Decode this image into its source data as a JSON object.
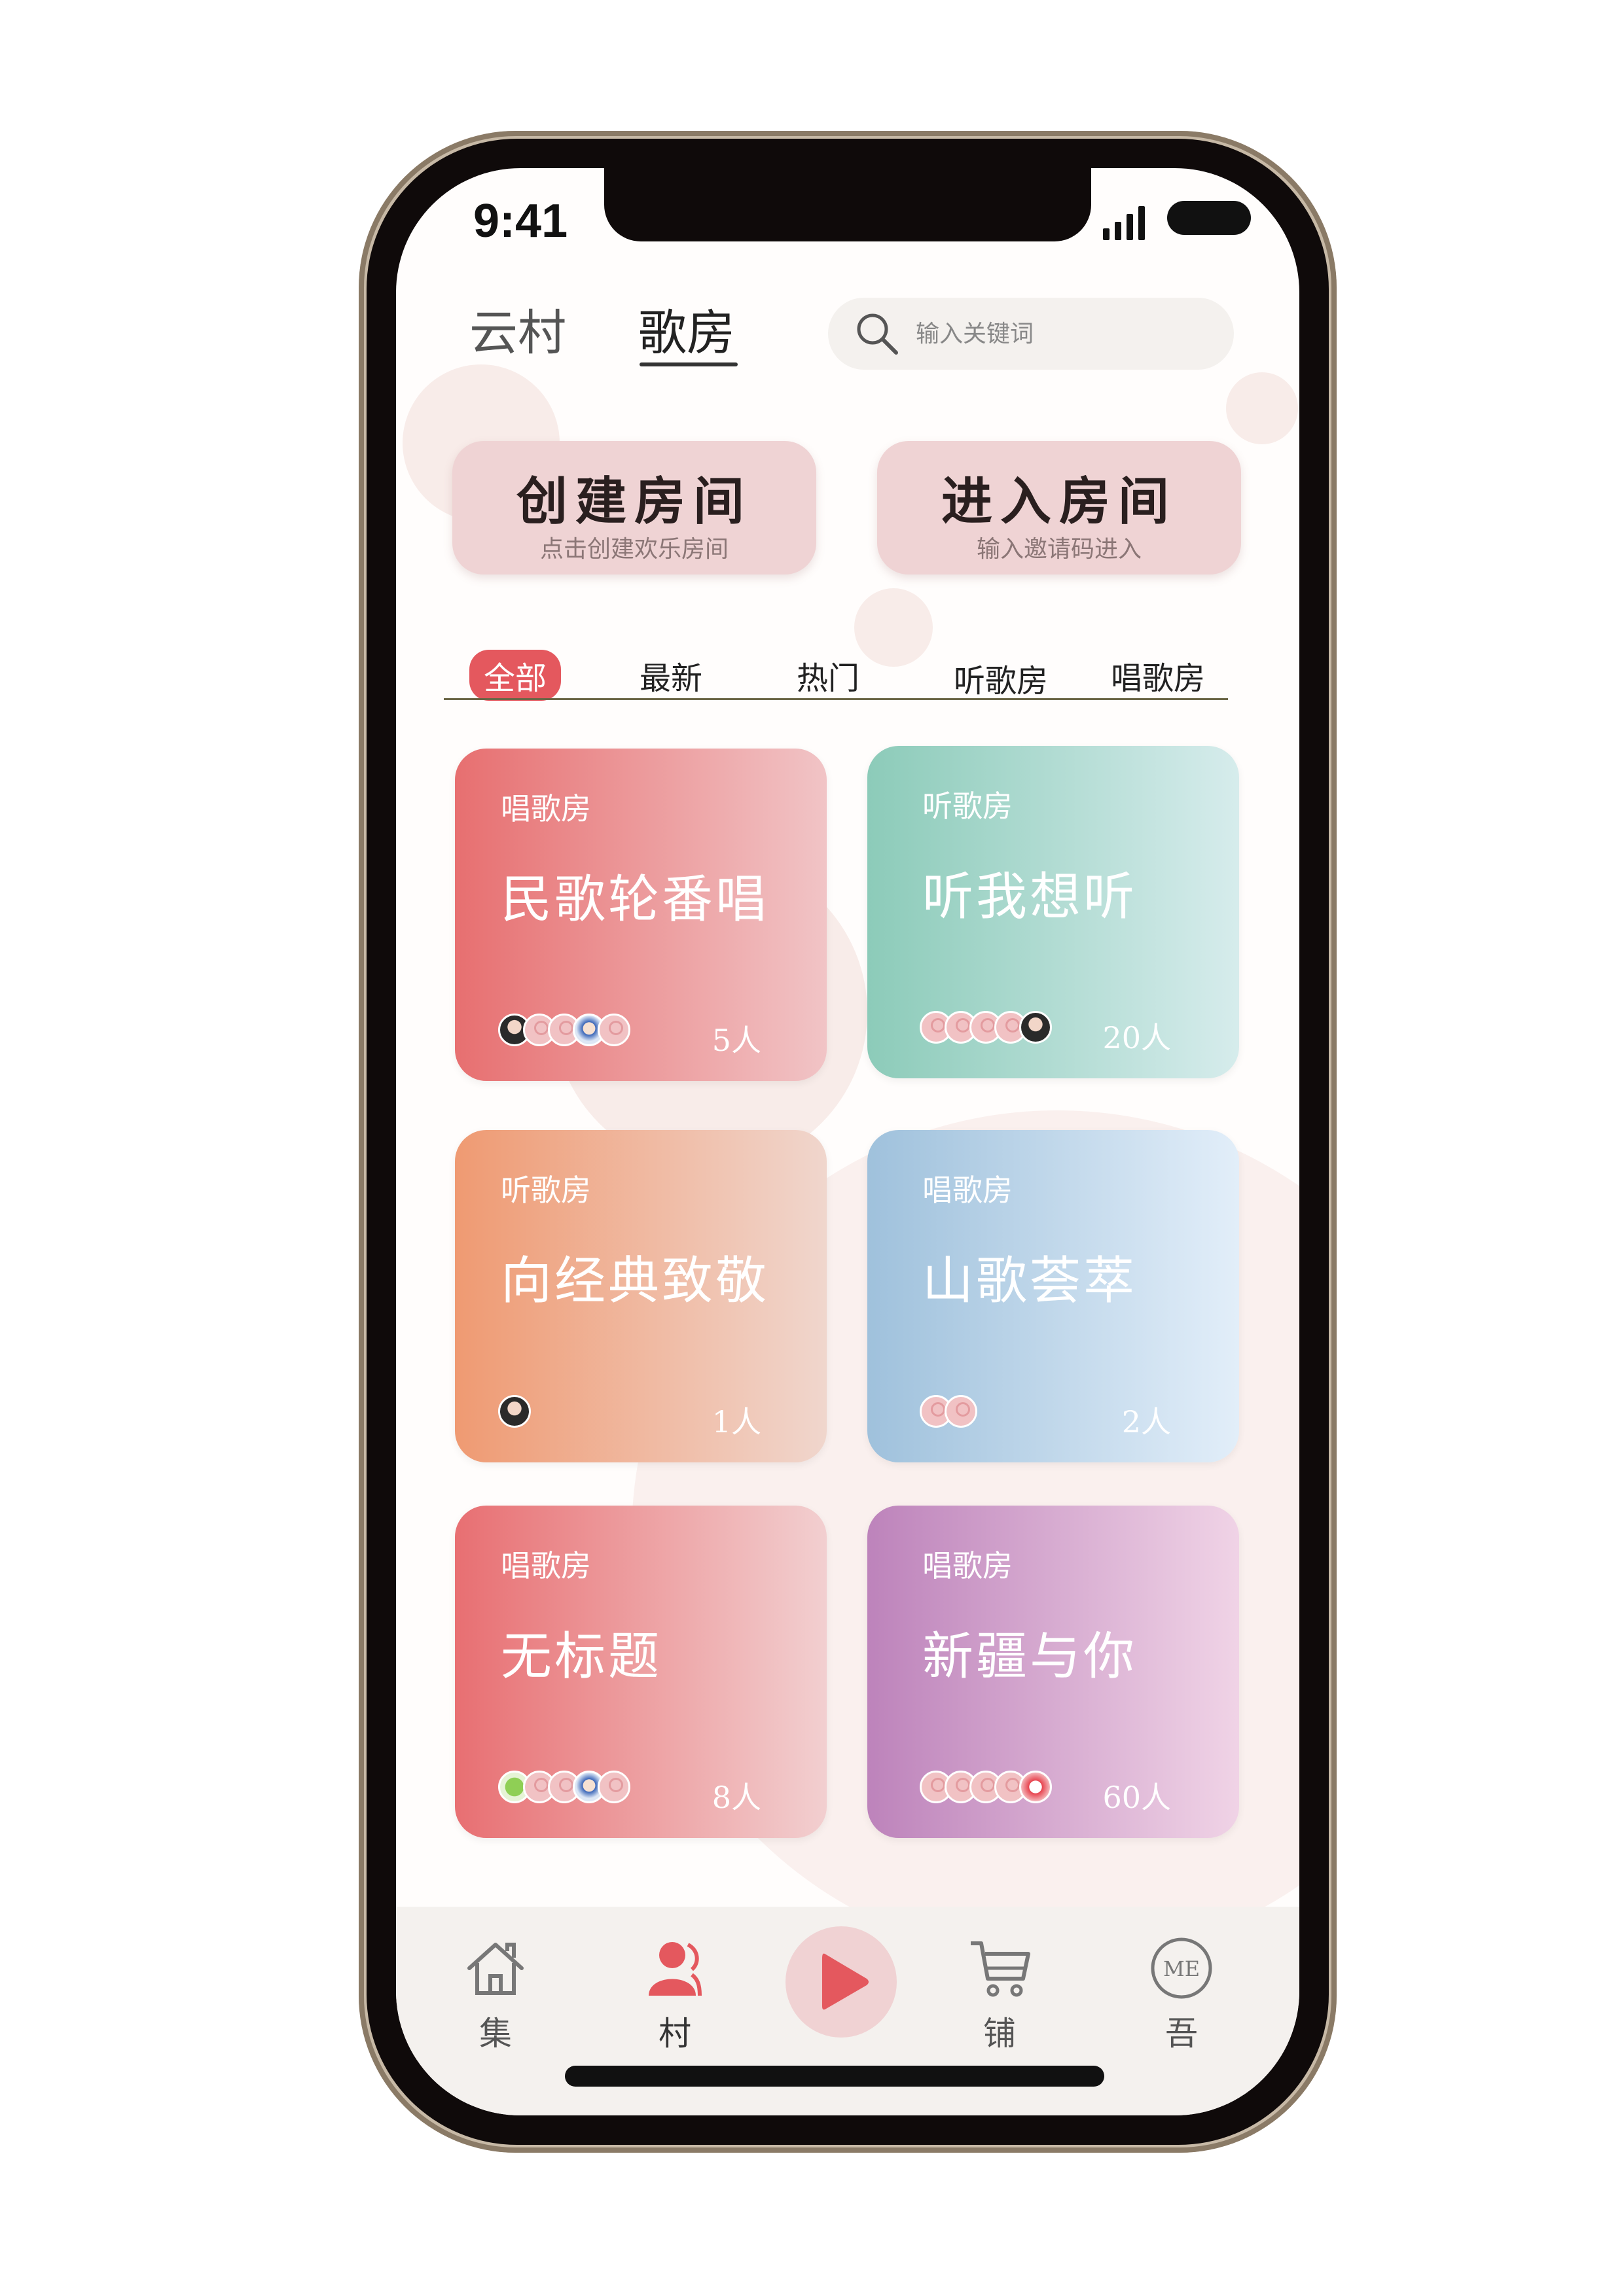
{
  "status_bar": {
    "time": "9:41"
  },
  "header": {
    "tabs": [
      {
        "label": "云村",
        "active": false
      },
      {
        "label": "歌房",
        "active": true
      }
    ],
    "search": {
      "placeholder": "输入关键词"
    }
  },
  "actions": [
    {
      "title": "创建房间",
      "subtitle": "点击创建欢乐房间"
    },
    {
      "title": "进入房间",
      "subtitle": "输入邀请码进入"
    }
  ],
  "categories": [
    "全部",
    "最新",
    "热门",
    "听歌房",
    "唱歌房"
  ],
  "active_category": "全部",
  "rooms": [
    {
      "type": "唱歌房",
      "title": "民歌轮番唱",
      "count": "5人",
      "gradient": [
        "#e76f70",
        "#f1c4c6"
      ]
    },
    {
      "type": "听歌房",
      "title": "听我想听",
      "count": "20人",
      "gradient": [
        "#8ccbb9",
        "#d6ecec"
      ]
    },
    {
      "type": "听歌房",
      "title": "向经典致敬",
      "count": "1人",
      "gradient": [
        "#ef9a72",
        "#f0d6cd"
      ]
    },
    {
      "type": "唱歌房",
      "title": "山歌荟萃",
      "count": "2人",
      "gradient": [
        "#9fc1dc",
        "#e2eef9"
      ]
    },
    {
      "type": "唱歌房",
      "title": "无标题",
      "count": "8人",
      "gradient": [
        "#e86f72",
        "#f2cfd0"
      ]
    },
    {
      "type": "唱歌房",
      "title": "新疆与你",
      "count": "60人",
      "gradient": [
        "#bd83bb",
        "#f0d3e6"
      ]
    }
  ],
  "bottom_nav": [
    {
      "label": "集",
      "icon": "home-icon"
    },
    {
      "label": "村",
      "icon": "people-icon",
      "active": true
    },
    {
      "label": "",
      "icon": "play-icon"
    },
    {
      "label": "铺",
      "icon": "cart-icon"
    },
    {
      "label": "吾",
      "icon": "me-icon",
      "icon_text": "ME"
    }
  ],
  "colors": {
    "accent": "#e4585e",
    "button_bg": "#efd3d4",
    "bar_bg": "#f4f1ee"
  }
}
